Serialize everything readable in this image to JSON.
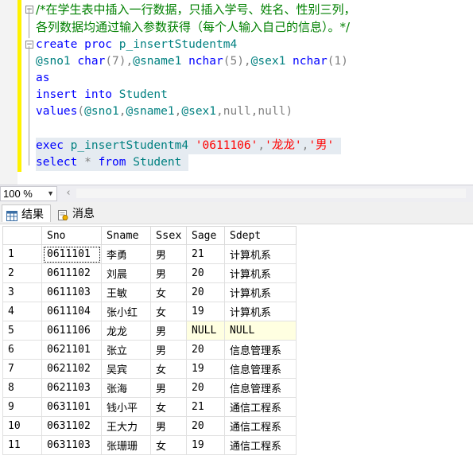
{
  "editor": {
    "lines": [
      {
        "text": "/*在学生表中插入一行数据，只插入学号、姓名、性别三列，"
      },
      {
        "text": "各列数据均通过输入参数获得（每个人输入自己的信息）。*/"
      },
      {
        "tokens": [
          {
            "t": "create proc ",
            "c": "kw"
          },
          {
            "t": "p_insertStudentm4",
            "c": "tbl"
          }
        ]
      },
      {
        "tokens": [
          {
            "t": "@sno1 ",
            "c": "tbl"
          },
          {
            "t": "char",
            "c": "kw"
          },
          {
            "t": "(7),",
            "c": "gr"
          },
          {
            "t": "@sname1 ",
            "c": "tbl"
          },
          {
            "t": "nchar",
            "c": "kw"
          },
          {
            "t": "(5),",
            "c": "gr"
          },
          {
            "t": "@sex1 ",
            "c": "tbl"
          },
          {
            "t": "nchar",
            "c": "kw"
          },
          {
            "t": "(1)",
            "c": "gr"
          }
        ]
      },
      {
        "tokens": [
          {
            "t": "as",
            "c": "kw"
          }
        ]
      },
      {
        "tokens": [
          {
            "t": "insert ",
            "c": "kw"
          },
          {
            "t": "into ",
            "c": "kw"
          },
          {
            "t": "Student",
            "c": "tbl"
          }
        ]
      },
      {
        "tokens": [
          {
            "t": "values",
            "c": "kw"
          },
          {
            "t": "(",
            "c": "gr"
          },
          {
            "t": "@sno1",
            "c": "tbl"
          },
          {
            "t": ",",
            "c": "gr"
          },
          {
            "t": "@sname1",
            "c": "tbl"
          },
          {
            "t": ",",
            "c": "gr"
          },
          {
            "t": "@sex1",
            "c": "tbl"
          },
          {
            "t": ",",
            "c": "gr"
          },
          {
            "t": "null",
            "c": "gr"
          },
          {
            "t": ",",
            "c": "gr"
          },
          {
            "t": "null",
            "c": "gr"
          },
          {
            "t": ")",
            "c": "gr"
          }
        ]
      },
      {
        "tokens": []
      },
      {
        "tokens": [
          {
            "t": "exec ",
            "c": "kw"
          },
          {
            "t": "p_insertStudentm4 ",
            "c": "tbl"
          },
          {
            "t": "'0611106'",
            "c": "str"
          },
          {
            "t": ",",
            "c": "gr"
          },
          {
            "t": "'龙龙'",
            "c": "str"
          },
          {
            "t": ",",
            "c": "gr"
          },
          {
            "t": "'男'",
            "c": "str"
          },
          {
            "t": " ",
            "c": "var"
          }
        ]
      },
      {
        "tokens": [
          {
            "t": "select ",
            "c": "kw"
          },
          {
            "t": "* ",
            "c": "gr"
          },
          {
            "t": "from ",
            "c": "kw"
          },
          {
            "t": "Student",
            "c": "tbl"
          },
          {
            "t": " ",
            "c": "var"
          }
        ]
      }
    ]
  },
  "zoom": {
    "value": "100 %"
  },
  "tabs": {
    "results": "结果",
    "messages": "消息"
  },
  "grid": {
    "columns": [
      "",
      "Sno",
      "Sname",
      "Ssex",
      "Sage",
      "Sdept"
    ],
    "rows": [
      [
        "1",
        "0611101",
        "李勇",
        "男",
        "21",
        "计算机系"
      ],
      [
        "2",
        "0611102",
        "刘晨",
        "男",
        "20",
        "计算机系"
      ],
      [
        "3",
        "0611103",
        "王敏",
        "女",
        "20",
        "计算机系"
      ],
      [
        "4",
        "0611104",
        "张小红",
        "女",
        "19",
        "计算机系"
      ],
      [
        "5",
        "0611106",
        "龙龙",
        "男",
        "NULL",
        "NULL"
      ],
      [
        "6",
        "0621101",
        "张立",
        "男",
        "20",
        "信息管理系"
      ],
      [
        "7",
        "0621102",
        "吴宾",
        "女",
        "19",
        "信息管理系"
      ],
      [
        "8",
        "0621103",
        "张海",
        "男",
        "20",
        "信息管理系"
      ],
      [
        "9",
        "0631101",
        "钱小平",
        "女",
        "21",
        "通信工程系"
      ],
      [
        "10",
        "0631102",
        "王大力",
        "男",
        "20",
        "通信工程系"
      ],
      [
        "11",
        "0631103",
        "张珊珊",
        "女",
        "19",
        "通信工程系"
      ]
    ]
  },
  "colors": {
    "keyword": "#0000ff",
    "comment": "#008000",
    "string": "#ff0000",
    "identifier": "#008080",
    "change_bar": "#fff200",
    "null_cell": "#ffffe1"
  }
}
